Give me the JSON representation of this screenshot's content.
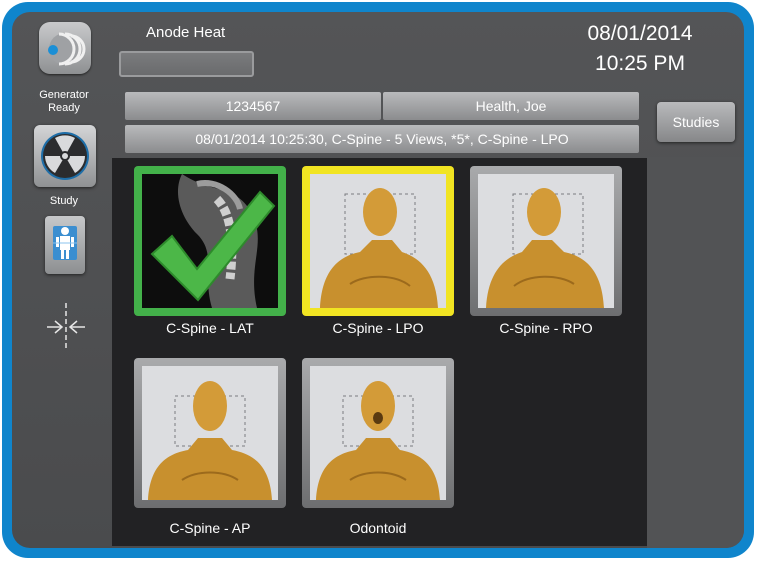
{
  "status": {
    "generator_ready": "Generator\nReady",
    "study_label": "Study"
  },
  "header": {
    "anode_heat_label": "Anode Heat",
    "date": "08/01/2014",
    "time": "10:25 PM"
  },
  "patient": {
    "id": "1234567",
    "name": "Health, Joe",
    "study_description": "08/01/2014 10:25:30, C-Spine - 5 Views, *5*, C-Spine - LPO"
  },
  "buttons": {
    "studies": "Studies"
  },
  "views": [
    {
      "caption": "C-Spine - LAT",
      "state": "completed",
      "border_color": "#43b14a"
    },
    {
      "caption": "C-Spine - LPO",
      "state": "selected",
      "border_color": "#f1e422"
    },
    {
      "caption": "C-Spine - RPO",
      "state": "pending",
      "border_color": "#8a8b8d"
    },
    {
      "caption": "C-Spine - AP",
      "state": "pending",
      "border_color": "#8a8b8d"
    },
    {
      "caption": "Odontoid",
      "state": "pending",
      "border_color": "#8a8b8d"
    }
  ],
  "icons": {
    "logo": "generator-logo-icon",
    "radiation": "radiation-icon",
    "study": "study-body-icon",
    "collimator": "collimator-icon",
    "check": "checkmark-icon"
  },
  "colors": {
    "frame": "#0f85cc",
    "panel": "#4e4f51",
    "accent_complete": "#43b14a",
    "accent_selected": "#f1e422"
  }
}
